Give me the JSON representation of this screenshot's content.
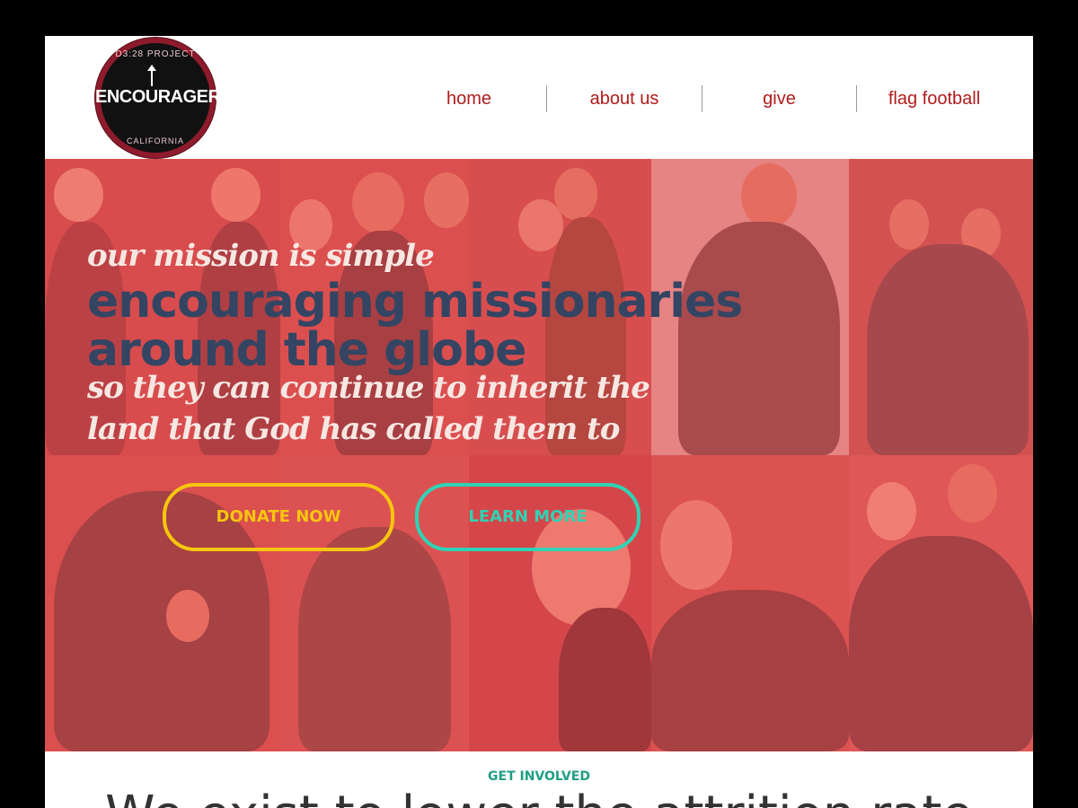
{
  "logo": {
    "top_text": "D3:28 PROJECT",
    "word": "ENCOURAGER",
    "bottom_text": "CALIFORNIA"
  },
  "nav": {
    "items": [
      {
        "label": "home"
      },
      {
        "label": "about us"
      },
      {
        "label": "give"
      },
      {
        "label": "flag football"
      }
    ]
  },
  "hero": {
    "tagline_small": "our mission is simple",
    "headline": "encouraging missionaries around the globe",
    "subline": "so they can continue to inherit the land that God has called them to",
    "donate_label": "DONATE NOW",
    "learn_label": "LEARN MORE",
    "colors": {
      "overlay": "#ff5050",
      "headline": "#334563",
      "donate": "#f7c60e",
      "learn": "#2fd3b4"
    }
  },
  "section": {
    "eyebrow": "GET INVOLVED",
    "headline": "We exist to lower the attrition rate"
  }
}
